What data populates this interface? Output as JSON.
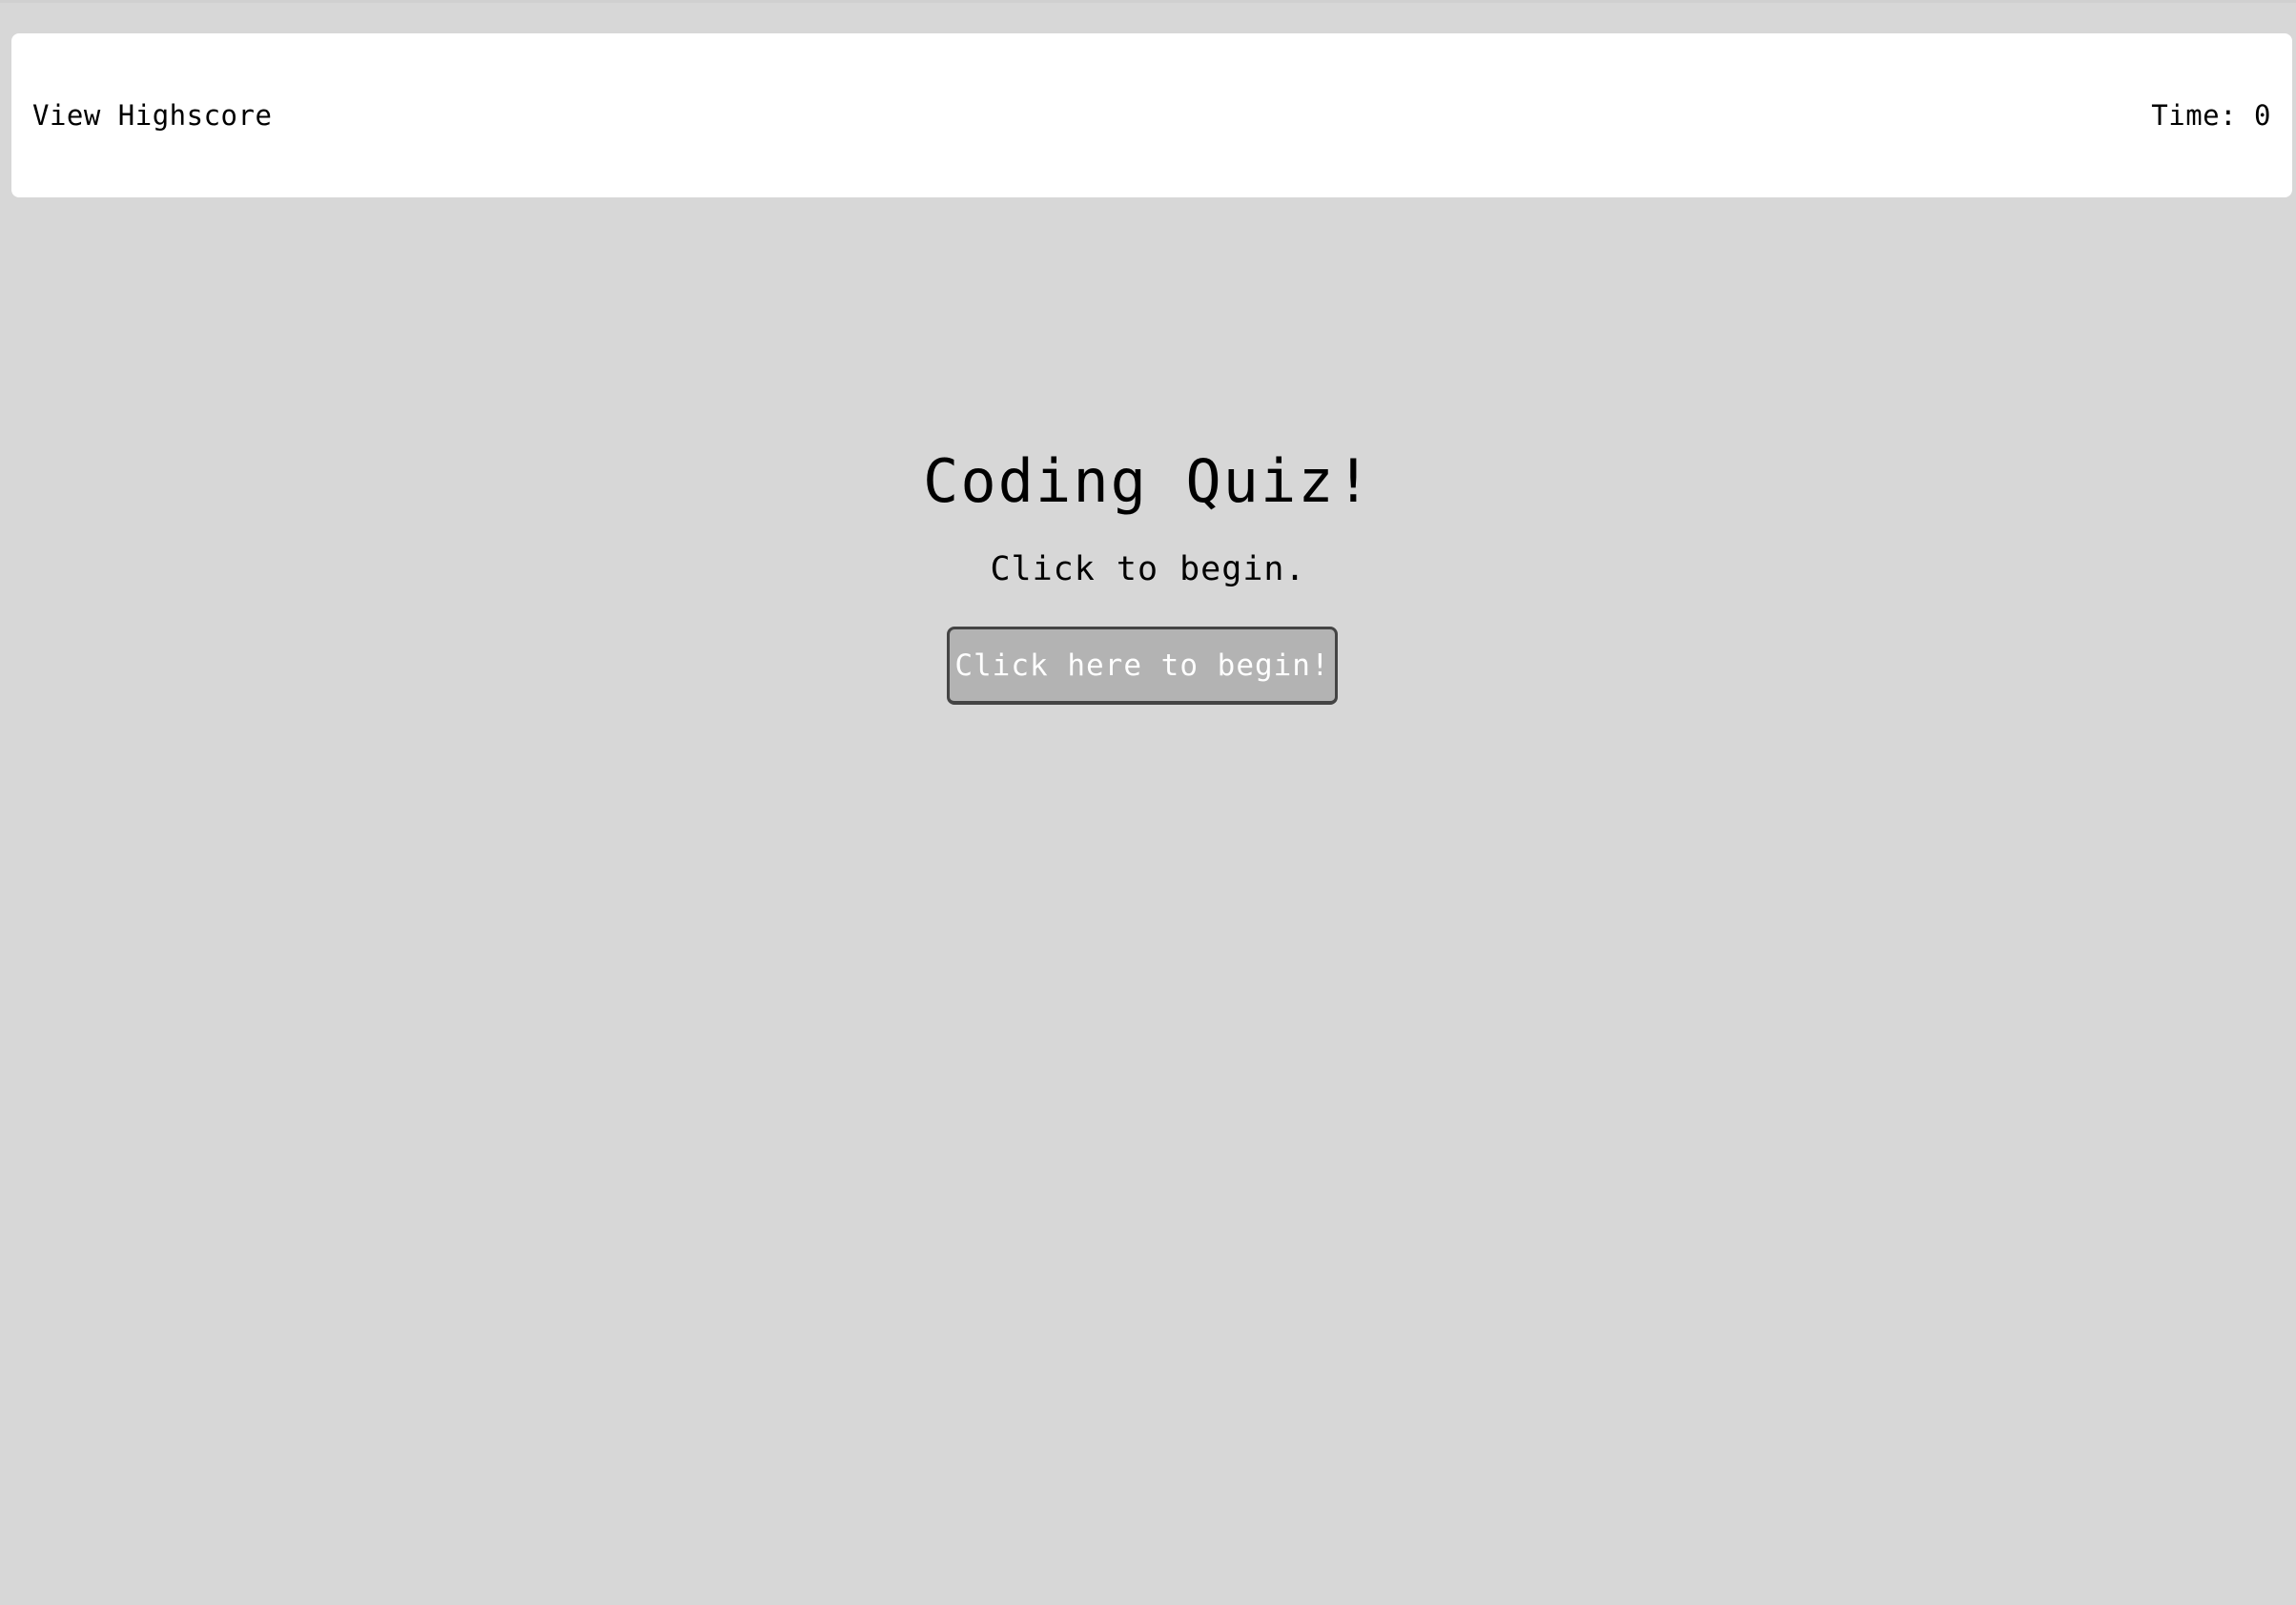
{
  "header": {
    "highscore_link": "View Highscore",
    "timer_text": "Time: 0"
  },
  "main": {
    "title": "Coding Quiz!",
    "subtitle": "Click to begin.",
    "start_button_label": "Click here to begin!"
  },
  "colors": {
    "background": "#d7d7d7",
    "header_background": "#ffffff",
    "button_background": "#b3b3b3",
    "button_text": "#ffffff",
    "button_border": "#444444"
  }
}
